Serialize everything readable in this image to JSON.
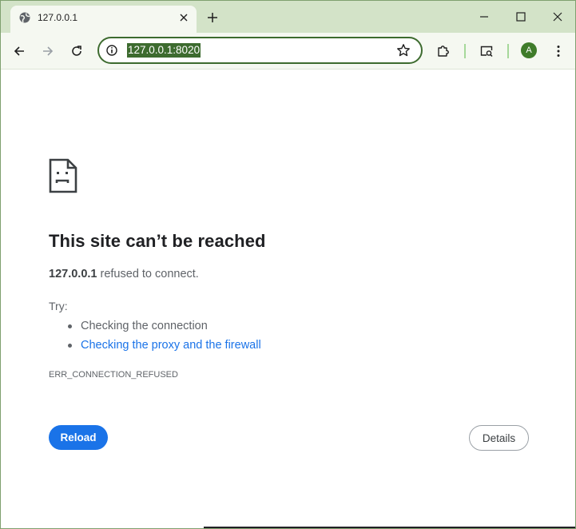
{
  "tab": {
    "title": "127.0.0.1"
  },
  "omnibox": {
    "url": "127.0.0.1:8020"
  },
  "profile": {
    "initial": "A"
  },
  "error": {
    "heading": "This site can’t be reached",
    "host": "127.0.0.1",
    "message": " refused to connect.",
    "try_label": "Try:",
    "suggestions": [
      "Checking the connection",
      "Checking the proxy and the firewall"
    ],
    "code": "ERR_CONNECTION_REFUSED"
  },
  "buttons": {
    "reload": "Reload",
    "details": "Details"
  },
  "icons": {
    "favicon": "globe-icon",
    "tab_close": "close-icon",
    "new_tab": "plus-icon",
    "back": "arrow-left-icon",
    "forward": "arrow-right-icon",
    "refresh": "refresh-icon",
    "site_info": "info-icon",
    "bookmark": "star-icon",
    "extensions": "puzzle-icon",
    "tab_search": "tab-search-icon",
    "menu": "kebab-menu-icon",
    "sad_page": "sad-page-icon"
  },
  "colors": {
    "frame": "#d3e3c8",
    "toolbar": "#f5f8f1",
    "accent": "#3d6b2f",
    "link": "#1a73e8",
    "button": "#1a73e8"
  }
}
